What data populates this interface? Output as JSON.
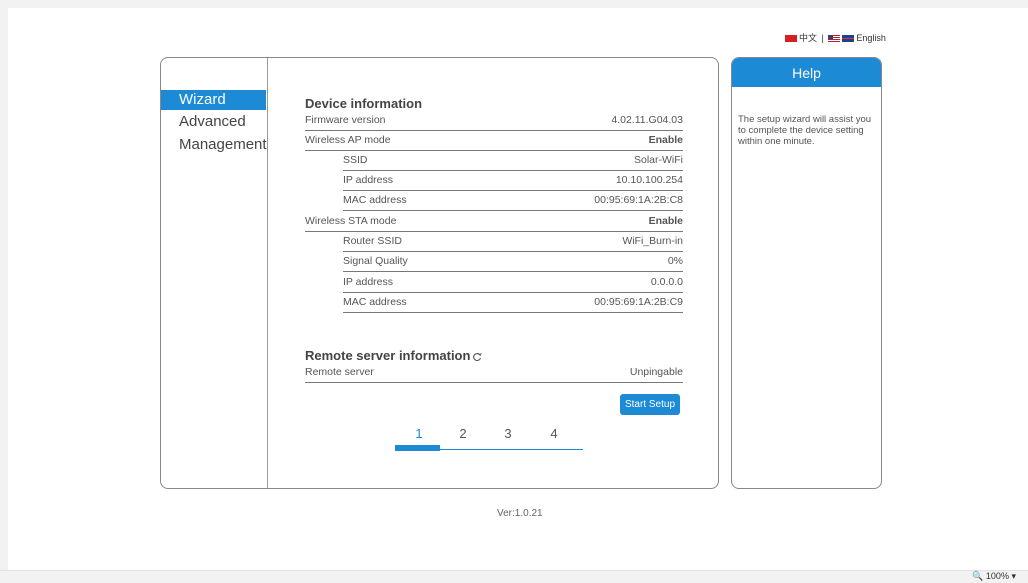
{
  "language": {
    "chinese": "中文",
    "separator": "|",
    "english": "English"
  },
  "nav": {
    "items": [
      {
        "label": "Wizard",
        "active": true
      },
      {
        "label": "Advanced",
        "active": false
      },
      {
        "label": "Management",
        "active": false
      }
    ]
  },
  "device": {
    "title": "Device information",
    "rows": [
      {
        "label": "Firmware version",
        "value": "4.02.11.G04.03"
      },
      {
        "label": "Wireless AP mode",
        "value": "Enable"
      },
      {
        "label": "SSID",
        "value": "Solar-WiFi"
      },
      {
        "label": "IP address",
        "value": "10.10.100.254"
      },
      {
        "label": "MAC address",
        "value": "00:95:69:1A:2B:C8"
      },
      {
        "label": "Wireless STA mode",
        "value": "Enable"
      },
      {
        "label": "Router SSID",
        "value": "WiFi_Burn-in"
      },
      {
        "label": "Signal Quality",
        "value": "0%"
      },
      {
        "label": "IP address",
        "value": "0.0.0.0"
      },
      {
        "label": "MAC address",
        "value": "00:95:69:1A:2B:C9"
      }
    ]
  },
  "remote": {
    "title": "Remote server information",
    "label": "Remote server",
    "value": "Unpingable",
    "icon": "refresh-icon"
  },
  "start_button": "Start Setup",
  "steps": [
    "1",
    "2",
    "3",
    "4"
  ],
  "help": {
    "title": "Help",
    "text": "The setup wizard will assist you to complete the device setting within one minute."
  },
  "version": "Ver:1.0.21",
  "zoom": "100%",
  "colors": {
    "accent": "#1d8ad6"
  }
}
